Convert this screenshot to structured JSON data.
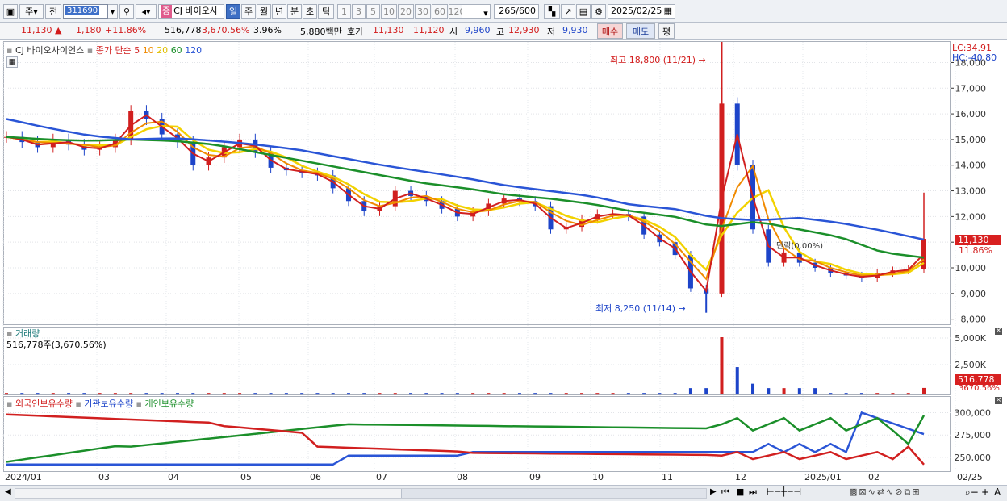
{
  "toolbar": {
    "period_main": "주",
    "prev_label": "전",
    "code": "311690",
    "badge": "증",
    "name": "CJ 바이오사",
    "periods": [
      "일",
      "주",
      "월",
      "년",
      "분",
      "초",
      "틱"
    ],
    "intervals": [
      "1",
      "3",
      "5",
      "10",
      "20",
      "30",
      "60",
      "120"
    ],
    "count": "265",
    "count_total": "/600",
    "date": "2025/02/25"
  },
  "quote": {
    "price": "11,130",
    "change": "1,180",
    "change_pct": "+11.86%",
    "volume": "516,778",
    "vol_pct": "3,670.56%",
    "turnover": "3.96%",
    "amount": "5,880백만",
    "ask_label": "호가",
    "ask1": "11,130",
    "bid1": "11,120",
    "open_label": "시",
    "open": "9,960",
    "high_label": "고",
    "high": "12,930",
    "low_label": "저",
    "low": "9,930",
    "buy_label": "매수",
    "sell_label": "매도",
    "eval_label": "평"
  },
  "chart": {
    "series_name": "CJ 바이오사이언스",
    "ma_title": "종가 단순",
    "ma_periods": [
      "5",
      "10",
      "20",
      "60",
      "120"
    ],
    "ma_colors": [
      "#d11f1f",
      "#f08a00",
      "#f2d200",
      "#1b8f2a",
      "#2a55d6"
    ],
    "lc": "LC:34.91",
    "hc": "HC:-40.80",
    "high_note": "최고 18,800 (11/21)",
    "low_note": "최저 8,250 (11/14)",
    "price_label": "11,130",
    "pct_label": "11.86%",
    "drop_note": "단락(0.00%)",
    "y_ticks": [
      "18,000",
      "17,000",
      "16,000",
      "15,000",
      "14,000",
      "13,000",
      "12,000",
      "11,000",
      "10,000",
      "9,000",
      "8,000"
    ],
    "volume_title": "거래량",
    "volume_value": "516,778주(3,670.56%)",
    "vol_ticks": [
      "5,000K",
      "2,500K"
    ],
    "vol_box": "516,778",
    "vol_pct_label": "3670.56%",
    "holding_legend": [
      "외국인보유수량",
      "기관보유수량",
      "개인보유수량"
    ],
    "hold_ticks": [
      "300,000",
      "275,000",
      "250,000"
    ],
    "x_labels": [
      "2024/01",
      "03",
      "04",
      "05",
      "06",
      "07",
      "08",
      "09",
      "10",
      "11",
      "12",
      "2025/01",
      "02",
      "02/25"
    ]
  },
  "chart_data": {
    "type": "line",
    "price": {
      "high": 18800,
      "high_date": "11/21",
      "low": 8250,
      "low_date": "11/14",
      "last": 11130,
      "open": 9960,
      "day_high": 12930,
      "day_low": 9930
    },
    "ylim": [
      7800,
      18800
    ],
    "moving_averages": [
      {
        "name": "5",
        "color": "#d11f1f"
      },
      {
        "name": "10",
        "color": "#f08a00"
      },
      {
        "name": "20",
        "color": "#f2d200"
      },
      {
        "name": "60",
        "color": "#1b8f2a"
      },
      {
        "name": "120",
        "color": "#2a55d6"
      }
    ],
    "close_approx": [
      15100,
      14900,
      14700,
      15000,
      14800,
      14600,
      14700,
      15000,
      16100,
      15800,
      15200,
      14900,
      14000,
      14300,
      14700,
      15000,
      14500,
      13900,
      13800,
      13700,
      13600,
      13100,
      12600,
      12200,
      12400,
      13000,
      12800,
      12600,
      12300,
      12000,
      12200,
      12500,
      12700,
      12600,
      12400,
      11500,
      11600,
      11900,
      12100,
      12100,
      12000,
      11300,
      11000,
      10500,
      9200,
      9000,
      16400,
      14000,
      11500,
      10200,
      10600,
      10200,
      10000,
      9800,
      9700,
      9600,
      9800,
      9900,
      9950,
      11130
    ],
    "ma120_approx": [
      15800,
      15450,
      15150,
      15000,
      15050,
      14950,
      14800,
      14600,
      14300,
      14000,
      13750,
      13500,
      13200,
      13000,
      12800,
      12450,
      12300,
      11950,
      11850,
      11950,
      11750,
      11450,
      11100
    ],
    "ma60_approx": [
      15100,
      15000,
      14950,
      15000,
      14950,
      14800,
      14500,
      14200,
      13900,
      13600,
      13300,
      13100,
      12850,
      12700,
      12500,
      12200,
      12000,
      11600,
      11800,
      11500,
      11200,
      10600,
      10400
    ]
  }
}
